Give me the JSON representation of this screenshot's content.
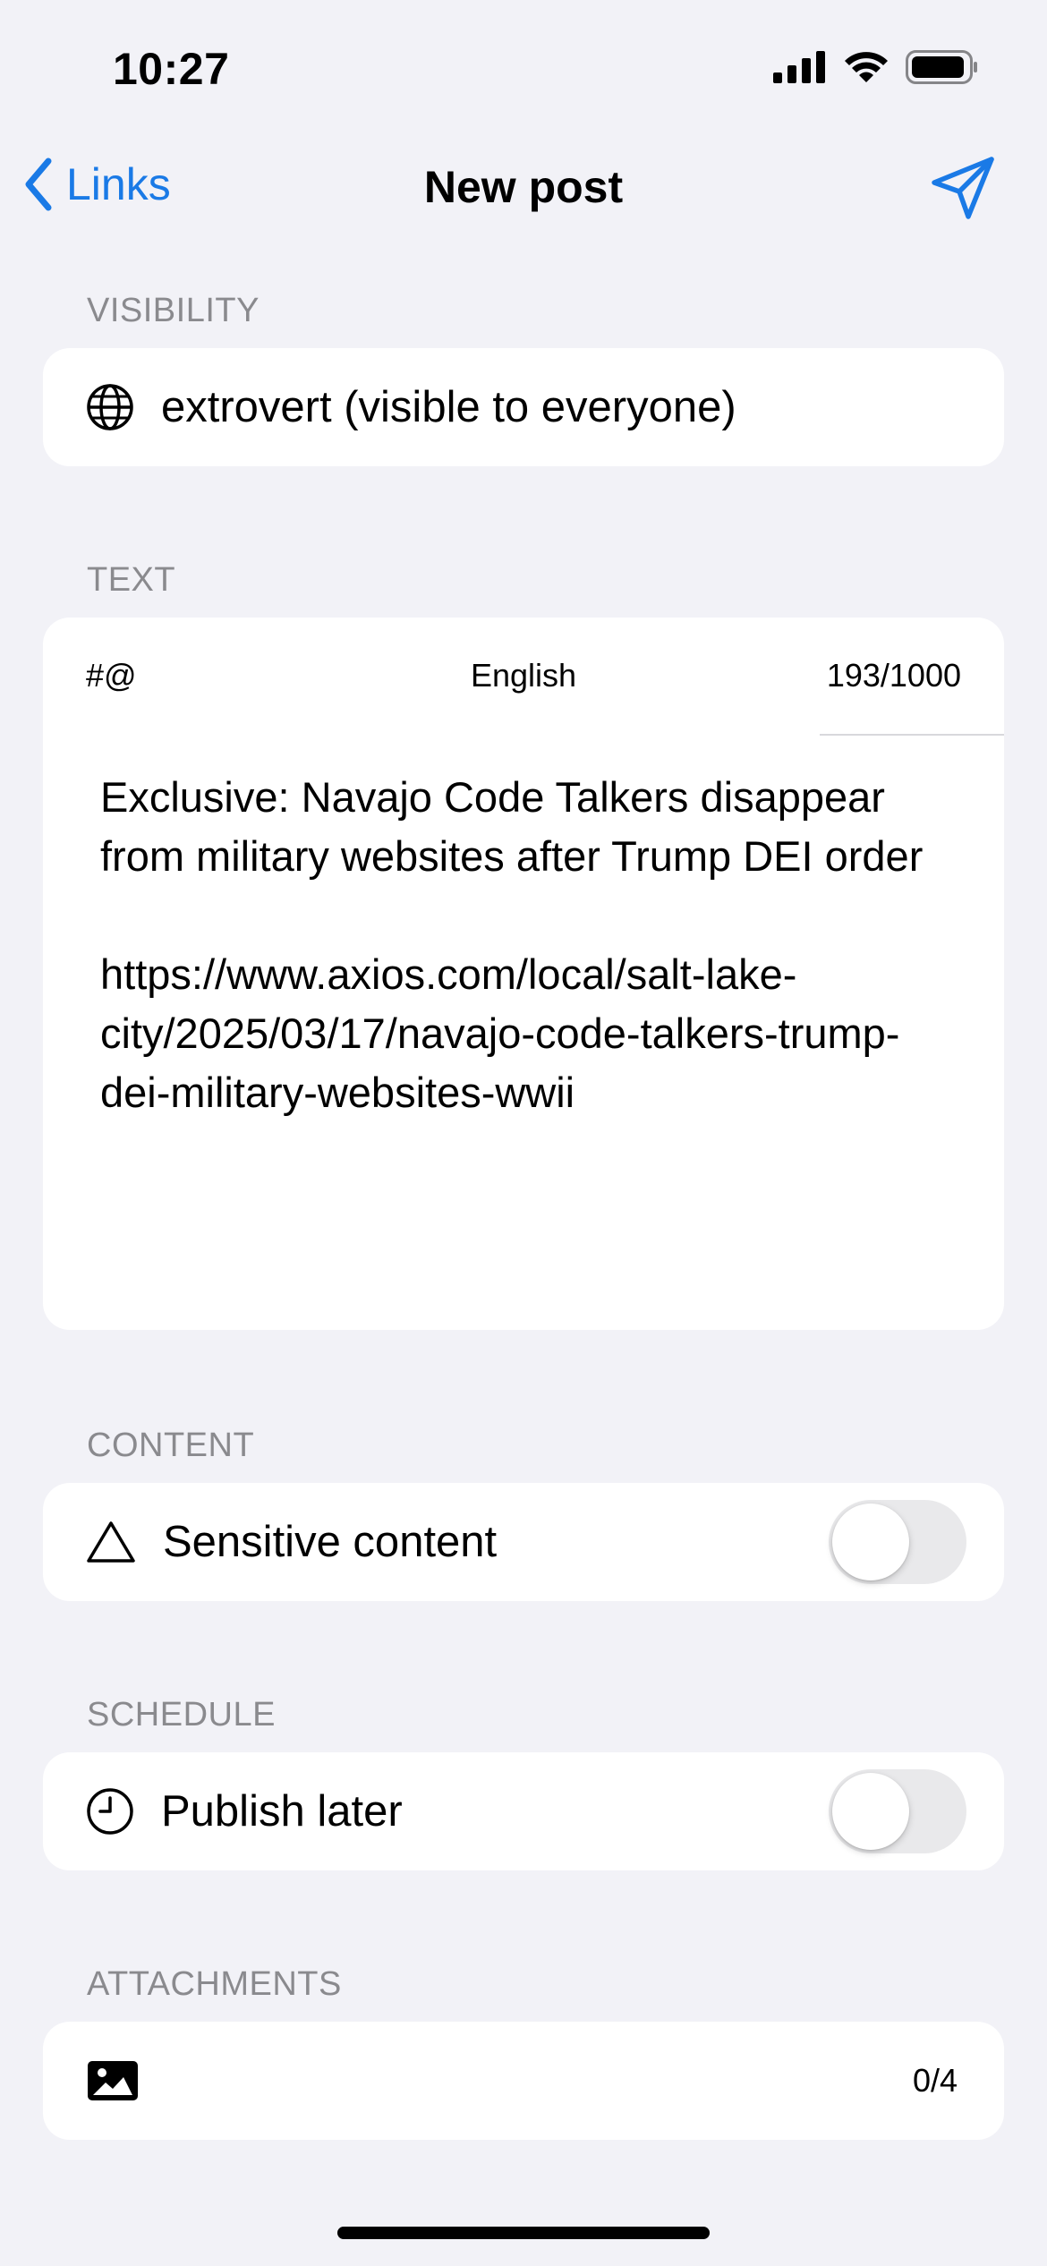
{
  "status_bar": {
    "time": "10:27"
  },
  "nav": {
    "back_label": "Links",
    "title": "New post"
  },
  "visibility": {
    "section_label": "VISIBILITY",
    "value": "extrovert (visible to everyone)"
  },
  "text": {
    "section_label": "TEXT",
    "hashtag_mention_label": "#@",
    "language": "English",
    "char_count": "193/1000",
    "body": "Exclusive: Navajo Code Talkers disappear from military websites after Trump DEI order\n\nhttps://www.axios.com/local/salt-lake-city/2025/03/17/navajo-code-talkers-trump-dei-military-websites-wwii"
  },
  "content": {
    "section_label": "CONTENT",
    "sensitive_label": "Sensitive content",
    "sensitive_enabled": false
  },
  "schedule": {
    "section_label": "SCHEDULE",
    "publish_later_label": "Publish later",
    "publish_later_enabled": false
  },
  "attachments": {
    "section_label": "ATTACHMENTS",
    "count": "0/4"
  },
  "colors": {
    "accent": "#1a7ae6",
    "background": "#f2f2f7",
    "card": "#ffffff",
    "section_label": "#8a8a8e",
    "toggle_off": "#e9e9eb"
  }
}
